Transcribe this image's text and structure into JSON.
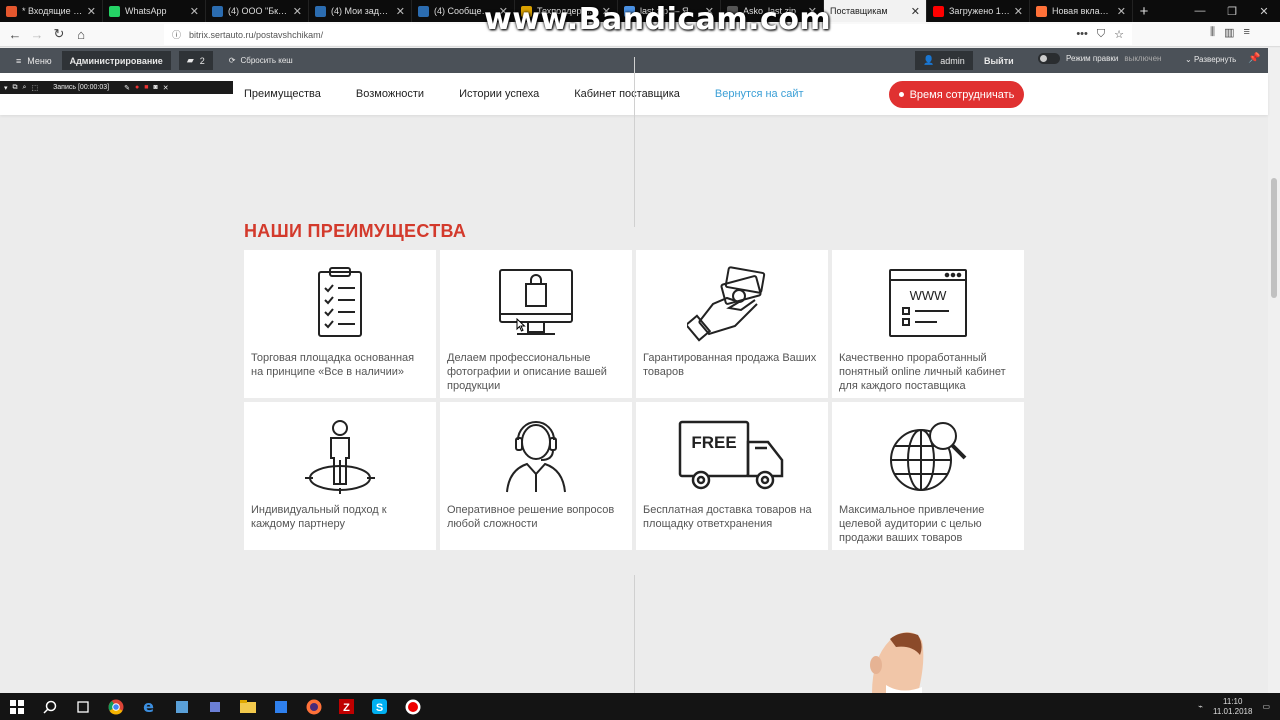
{
  "browser": {
    "tabs": [
      {
        "label": "* Входящие — Ян",
        "color": "#e4572e",
        "active": false
      },
      {
        "label": "WhatsApp",
        "color": "#25d366",
        "active": false
      },
      {
        "label": "(4) ООО \"Бкксоф",
        "color": "#2b6cb0",
        "active": false
      },
      {
        "label": "(4) Мои задачи",
        "color": "#2b6cb0",
        "active": false
      },
      {
        "label": "(4) Сообщения",
        "color": "#2b6cb0",
        "active": false
      },
      {
        "label": "Техподдержка",
        "color": "#d9a000",
        "active": false
      },
      {
        "label": "last.zip — Я",
        "color": "#4a90e2",
        "active": false
      },
      {
        "label": "Asko_last.zip",
        "color": "#555555",
        "active": false
      },
      {
        "label": "Поставщикам",
        "color": "#ffffff",
        "active": true
      },
      {
        "label": "Загружено 1 из 1",
        "color": "#ff0000",
        "active": false
      },
      {
        "label": "Новая вкладка",
        "color": "#ff7139",
        "active": false
      }
    ],
    "newtab_icon": "plus-icon",
    "url": "bitrix.sertauto.ru/postavshchikam/",
    "watermark": "www.Bandicam.com"
  },
  "admin": {
    "menu_label": "Меню",
    "admin_label": "Администрирование",
    "count": "2",
    "cache_label": "Сбросить кеш",
    "user": "admin",
    "exit_label": "Выйти",
    "mode_label": "Режим правки",
    "mode_state": "выключен",
    "expand_label": "Развернуть"
  },
  "recorder": {
    "label": "Запись [00:00:03]"
  },
  "site": {
    "nav": [
      "Преимущества",
      "Возможности",
      "Истории успеха",
      "Кабинет поставщика"
    ],
    "back_link": "Вернутся на сайт",
    "cta_label": "Время сотрудничать",
    "accent": "#e03131",
    "link_color": "#3b9fd6"
  },
  "advantages": {
    "title": "НАШИ ПРЕИМУЩЕСТВА",
    "title_color": "#d33a2c",
    "items": [
      {
        "icon": "clipboard-checklist-icon",
        "text": "Торговая площадка основанная на принципе «Все в наличии»"
      },
      {
        "icon": "monitor-shopping-bag-icon",
        "text": "Делаем профессиональные фотографии и описание вашей продукции"
      },
      {
        "icon": "hand-money-icon",
        "text": "Гарантированная продажа Ваших товаров"
      },
      {
        "icon": "browser-window-www-icon",
        "text": "Качественно проработанный понятный online личный кабинет для каждого поставщика"
      },
      {
        "icon": "person-target-icon",
        "text": "Индивидуальный подход к каждому партнеру"
      },
      {
        "icon": "support-headset-icon",
        "text": "Оперативное решение вопросов любой сложности"
      },
      {
        "icon": "free-delivery-truck-icon",
        "text": "Бесплатная доставка товаров на площадку ответхранения"
      },
      {
        "icon": "globe-search-icon",
        "text": "Максимальное привлечение целевой аудитории с целью продажи ваших товаров"
      }
    ],
    "truck_label": "FREE",
    "browser_label": "WWW"
  },
  "taskbar": {
    "time": "11:10",
    "date": "11.01.2018"
  }
}
